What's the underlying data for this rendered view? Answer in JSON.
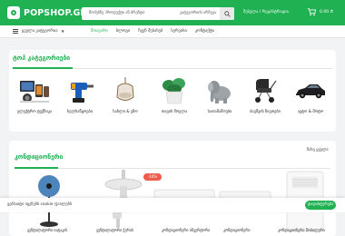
{
  "header": {
    "logo_text": "POPSHOP.GE",
    "search_placeholder": "მოძებნე პროდუქტი ან ბრენდი",
    "search_category": "კატეგორიის არჩევა",
    "auth_label": "შესვლა / რეგისტრაცია",
    "cart_price": "0.00 ₾"
  },
  "nav": {
    "categories_label": "ყველა კატეგორია",
    "links": [
      "მთავარი",
      "ბლოგი",
      "ჩვენ შესახებ",
      "სერვისი",
      "კონტაქტი"
    ]
  },
  "top_categories": {
    "title": "ტოპ კატეგორიები",
    "items": [
      {
        "label": "ელექტრო ტექნიკა",
        "icon": "electronics-image"
      },
      {
        "label": "ხელსაწყოები",
        "icon": "drill-image"
      },
      {
        "label": "სახლი & ეზო",
        "icon": "hanging-chair-image"
      },
      {
        "label": "თავის მოვლა",
        "icon": "plant-pot-image"
      },
      {
        "label": "სათამაშოები",
        "icon": "toy-elephant-image"
      },
      {
        "label": "ბავშვის ნივთები",
        "icon": "stroller-image"
      },
      {
        "label": "ავტო & მოტო",
        "icon": "car-image"
      }
    ]
  },
  "air_conditioners": {
    "title": "კონდიციონერი",
    "see_all": "ნახე ყველა",
    "discount_badge": "-16%",
    "product_names": [
      "ვენტილატორი იატაკის",
      "ვენტილატორი ჭერის",
      "კონდიციონერი ინვერტორი",
      "კონდიციონერი",
      "კონდიციონერი მობილური"
    ]
  },
  "cookie_banner": {
    "text": "ვებსაიტი იყენებს cookie ფაილებს",
    "accept_label": "დადასტურება"
  },
  "colors": {
    "brand_green": "#1fb152",
    "discount_red": "#ef5b4a"
  }
}
